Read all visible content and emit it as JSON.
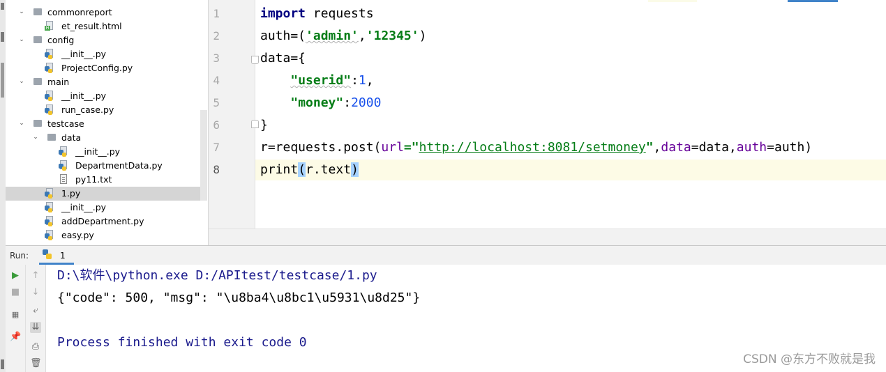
{
  "tree": {
    "items": [
      {
        "label": "commonreport",
        "type": "folder",
        "expanded": true
      },
      {
        "label": "et_result.html",
        "type": "html"
      },
      {
        "label": "config",
        "type": "folder",
        "expanded": true
      },
      {
        "label": "__init__.py",
        "type": "py"
      },
      {
        "label": "ProjectConfig.py",
        "type": "py"
      },
      {
        "label": "main",
        "type": "folder",
        "expanded": true
      },
      {
        "label": "__init__.py",
        "type": "py"
      },
      {
        "label": "run_case.py",
        "type": "py"
      },
      {
        "label": "testcase",
        "type": "folder",
        "expanded": true
      },
      {
        "label": "data",
        "type": "folder",
        "expanded": true
      },
      {
        "label": "__init__.py",
        "type": "py"
      },
      {
        "label": "DepartmentData.py",
        "type": "py"
      },
      {
        "label": "py11.txt",
        "type": "txt"
      },
      {
        "label": "1.py",
        "type": "py",
        "selected": true
      },
      {
        "label": "__init__.py",
        "type": "py"
      },
      {
        "label": "addDepartment.py",
        "type": "py"
      },
      {
        "label": "easy.py",
        "type": "py"
      }
    ]
  },
  "editor": {
    "line_numbers": [
      "1",
      "2",
      "3",
      "4",
      "5",
      "6",
      "7",
      "8"
    ],
    "current_line": "8",
    "lines": [
      [
        {
          "t": "import",
          "c": "kw"
        },
        {
          "t": " requests",
          "c": ""
        }
      ],
      [
        {
          "t": "auth=(",
          "c": ""
        },
        {
          "t": "'admin'",
          "c": "str squig"
        },
        {
          "t": ",",
          "c": ""
        },
        {
          "t": "'12345'",
          "c": "str"
        },
        {
          "t": ")",
          "c": ""
        }
      ],
      [
        {
          "t": "data={",
          "c": ""
        }
      ],
      [
        {
          "t": "    ",
          "c": ""
        },
        {
          "t": "\"userid\"",
          "c": "key squig"
        },
        {
          "t": ":",
          "c": ""
        },
        {
          "t": "1",
          "c": "num"
        },
        {
          "t": ",",
          "c": ""
        }
      ],
      [
        {
          "t": "    ",
          "c": ""
        },
        {
          "t": "\"money\"",
          "c": "key"
        },
        {
          "t": ":",
          "c": ""
        },
        {
          "t": "2000",
          "c": "num"
        }
      ],
      [
        {
          "t": "}",
          "c": ""
        }
      ],
      [
        {
          "t": "r=requests.post(",
          "c": ""
        },
        {
          "t": "url",
          "c": "param"
        },
        {
          "t": "=\"",
          "c": "str"
        },
        {
          "t": "http://localhost:8081/setmoney",
          "c": "url"
        },
        {
          "t": "\"",
          "c": "str"
        },
        {
          "t": ",",
          "c": ""
        },
        {
          "t": "data",
          "c": "param"
        },
        {
          "t": "=data,",
          "c": ""
        },
        {
          "t": "auth",
          "c": "param"
        },
        {
          "t": "=auth)",
          "c": ""
        }
      ],
      [
        {
          "t": "print",
          "c": ""
        },
        {
          "t": "(",
          "c": "bm"
        },
        {
          "t": "r.text",
          "c": ""
        },
        {
          "t": ")",
          "c": "bm"
        }
      ]
    ]
  },
  "run": {
    "label": "Run:",
    "tab_label": "1"
  },
  "console": {
    "lines": [
      {
        "text": "D:\\软件\\python.exe D:/APItest/testcase/1.py",
        "kind": "cmd"
      },
      {
        "text": "{\"code\": 500, \"msg\": \"\\u8ba4\\u8bc1\\u5931\\u8d25\"}",
        "kind": "out"
      },
      {
        "text": "",
        "kind": "out"
      },
      {
        "text": "Process finished with exit code 0",
        "kind": "proc"
      }
    ]
  },
  "watermark": "CSDN @东方不败就是我",
  "icons": {
    "run": "play-icon",
    "stop": "stop-icon",
    "up": "arrow-up-icon",
    "down": "arrow-down-icon",
    "wrap": "soft-wrap-icon",
    "scroll_end": "scroll-to-end-icon",
    "print": "print-icon",
    "delete": "trash-icon",
    "layout": "layout-icon",
    "pin": "pin-icon"
  }
}
